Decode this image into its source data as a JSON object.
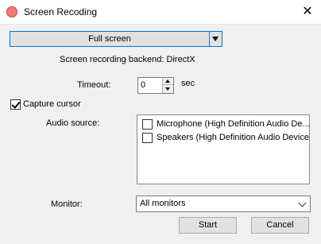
{
  "window": {
    "title": "Screen Recoding",
    "close_glyph": "✕"
  },
  "mode": {
    "selected": "Full screen"
  },
  "backend_text": "Screen recording backend: DirectX",
  "timeout": {
    "label": "Timeout:",
    "value": "0",
    "unit": "sec"
  },
  "capture_cursor": {
    "label": "Capture cursor",
    "checked": true
  },
  "audio": {
    "label": "Audio source:",
    "items": [
      {
        "label": "Microphone (High Definition Audio De...",
        "checked": false
      },
      {
        "label": "Speakers (High Definition Audio Device)",
        "checked": false
      }
    ]
  },
  "monitor": {
    "label": "Monitor:",
    "selected": "All monitors"
  },
  "buttons": {
    "start": "Start",
    "cancel": "Cancel"
  }
}
